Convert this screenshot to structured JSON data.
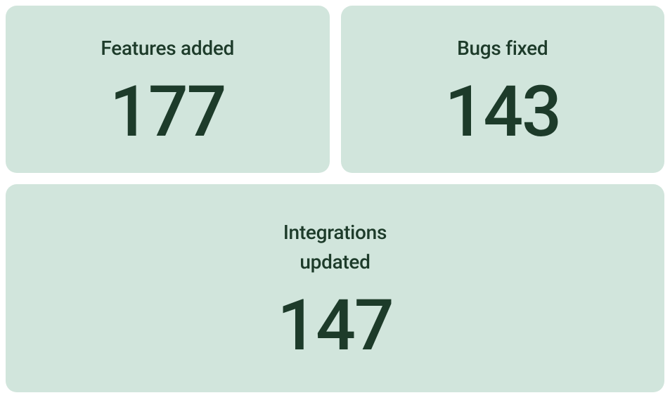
{
  "stats": [
    {
      "label": "Features added",
      "value": "177"
    },
    {
      "label": "Bugs fixed",
      "value": "143"
    },
    {
      "label": "Integrations updated",
      "value": "147"
    }
  ]
}
